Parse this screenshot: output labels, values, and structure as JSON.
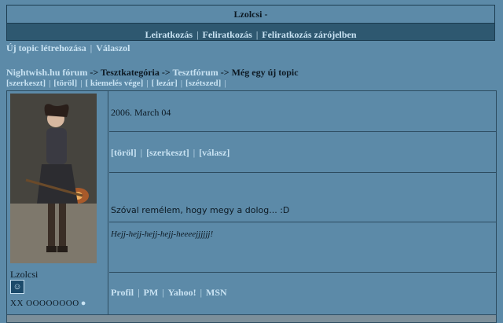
{
  "header": {
    "title": "Lzolcsi -",
    "menu": [
      "Leiratkozás",
      "Feliratkozás",
      "Feliratkozás zárójelben"
    ]
  },
  "topic_actions": [
    "Új topic létrehozása",
    "Válaszol"
  ],
  "breadcrumb": {
    "forum": "Nightwish.hu fórum",
    "arrow": "->",
    "category": "Tesztkategória",
    "subforum": "Tesztfórum",
    "topic": "Még egy új topic"
  },
  "admin": [
    "[szerkeszt]",
    "[töröl]",
    "[ kiemelés vége]",
    "[ lezár]",
    "[szétszed]"
  ],
  "post": {
    "author": "Lzolcsi",
    "rank": "XX OOOOOOOO",
    "rank_star": "●",
    "date": "2006. March 04",
    "actions": [
      "[töröl]",
      "[szerkeszt]",
      "[válasz]"
    ],
    "text": "Szóval remélem, hogy megy a dolog... :D",
    "signature": "Hejj-hejj-hejj-hejj-heeeejjjjjj!",
    "contact": [
      "Profil",
      "PM",
      "Yahoo!",
      "MSN"
    ]
  },
  "colors": {
    "background": "#5c8aa8",
    "link": "#c8e2f2",
    "menubar": "#2e5870",
    "border": "#2d4c60"
  }
}
